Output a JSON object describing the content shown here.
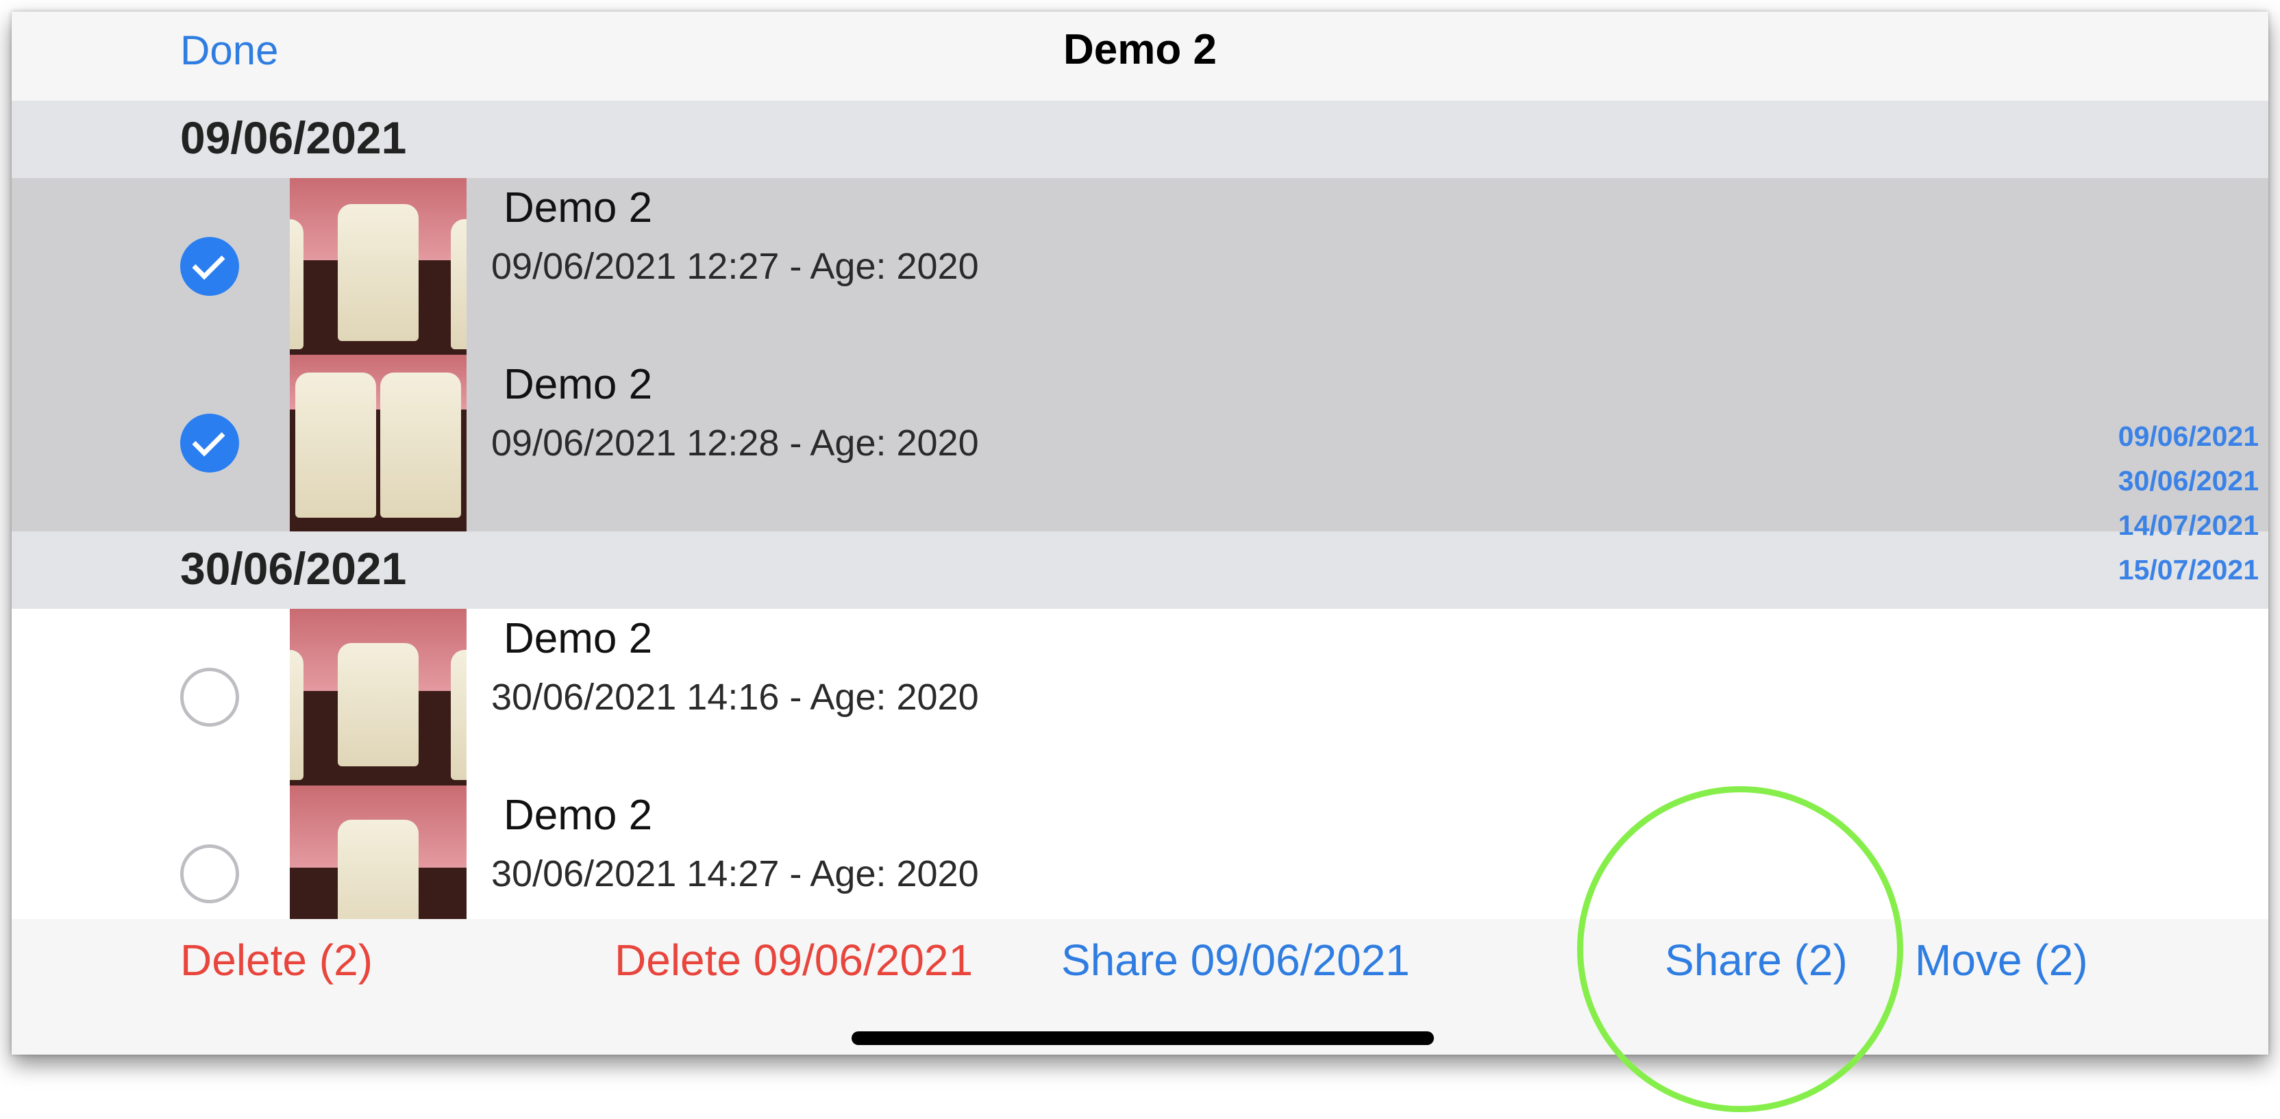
{
  "navbar": {
    "done_label": "Done",
    "title": "Demo 2"
  },
  "sections": [
    {
      "date": "09/06/2021",
      "items": [
        {
          "title": "Demo 2",
          "subtitle": "09/06/2021 12:27 - Age: 2020",
          "selected": true
        },
        {
          "title": "Demo 2",
          "subtitle": "09/06/2021 12:28 - Age: 2020",
          "selected": true
        }
      ]
    },
    {
      "date": "30/06/2021",
      "items": [
        {
          "title": "Demo 2",
          "subtitle": "30/06/2021 14:16 - Age: 2020",
          "selected": false
        },
        {
          "title": "Demo 2",
          "subtitle": "30/06/2021 14:27 - Age: 2020",
          "selected": false
        }
      ]
    }
  ],
  "section_index": [
    "09/06/2021",
    "30/06/2021",
    "14/07/2021",
    "15/07/2021"
  ],
  "toolbar": {
    "delete_selected": "Delete (2)",
    "delete_date": "Delete 09/06/2021",
    "share_date": "Share 09/06/2021",
    "share_selected": "Share (2)",
    "move_selected": "Move (2)"
  },
  "colors": {
    "accent": "#2f7de1",
    "destructive": "#e8453c",
    "highlight_ring": "#86ee4a"
  }
}
